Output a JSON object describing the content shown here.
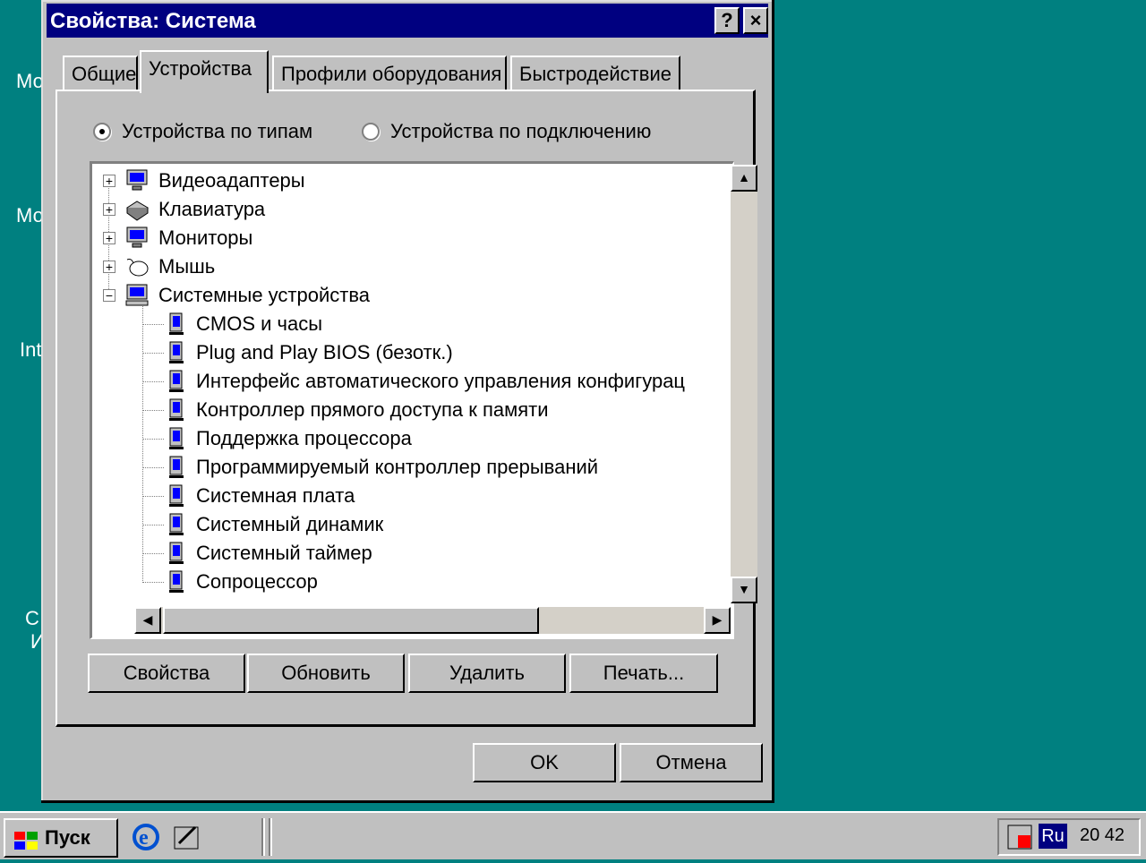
{
  "desktop": {
    "labels": [
      "Мо",
      "Мо",
      "Int",
      "С",
      "И"
    ]
  },
  "dialog": {
    "title": "Свойства: Система",
    "help_label": "?",
    "close_label": "×",
    "tabs": [
      "Общие",
      "Устройства",
      "Профили оборудования",
      "Быстродействие"
    ],
    "active_tab": "Устройства",
    "radio_by_type": "Устройства по типам",
    "radio_by_connection": "Устройства по подключению",
    "selected_view": "Устройства по типам",
    "tree": {
      "categories": [
        {
          "label": "Видеоадаптеры",
          "icon": "display-adapter-icon",
          "expanded": false
        },
        {
          "label": "Клавиатура",
          "icon": "keyboard-icon",
          "expanded": false
        },
        {
          "label": "Мониторы",
          "icon": "monitor-icon",
          "expanded": false
        },
        {
          "label": "Мышь",
          "icon": "mouse-icon",
          "expanded": false
        },
        {
          "label": "Системные устройства",
          "icon": "computer-icon",
          "expanded": true
        }
      ],
      "system_devices": [
        "CMOS и часы",
        "Plug and Play BIOS (безотк.)",
        "Интерфейс автоматического управления конфигурац",
        "Контроллер прямого доступа к памяти",
        "Поддержка процессора",
        "Программируемый контроллер прерываний",
        "Системная плата",
        "Системный динамик",
        "Системный таймер",
        "Сопроцессор"
      ]
    },
    "buttons": {
      "properties": "Свойства",
      "refresh": "Обновить",
      "remove": "Удалить",
      "print": "Печать...",
      "ok": "OK",
      "cancel": "Отмена"
    }
  },
  "taskbar": {
    "start_label": "Пуск",
    "tray_lang": "Ru",
    "clock": "20 42"
  },
  "colors": {
    "desktop": "#008080",
    "title_bar": "#000080",
    "face": "#c0c0c0",
    "icon_blue": "#0000ff"
  }
}
